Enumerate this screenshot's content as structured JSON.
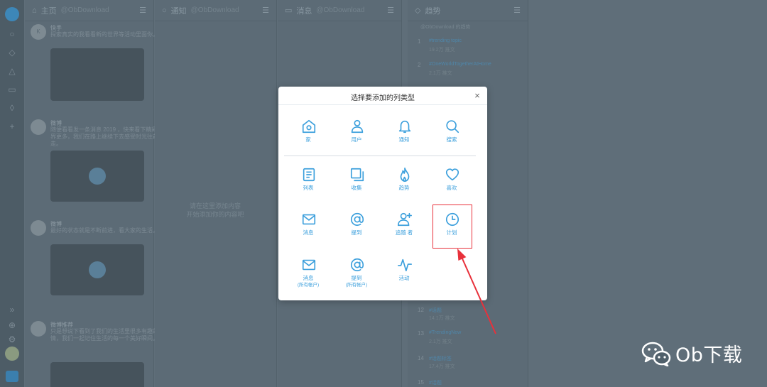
{
  "background": {
    "columns": [
      {
        "title": "主页",
        "subtitle": "@ObDownload",
        "icon": "home-icon"
      },
      {
        "title": "通知",
        "subtitle": "@ObDownload",
        "icon": "bell-icon"
      },
      {
        "title": "消息",
        "subtitle": "@ObDownload",
        "icon": "mail-icon"
      },
      {
        "title": "趋势",
        "subtitle": "",
        "icon": "trend-icon"
      }
    ],
    "tweets": [
      {
        "name": "快手",
        "text": "探索真实的我看看新的世界等活动里面你。"
      },
      {
        "name": "微博",
        "text": "随便看看发一条消息 2019 ，快来看下精彩世界更多，我们在路上继续下去感受时光往前走。"
      },
      {
        "name": "微博",
        "text": "最好的状态就是不断前进，看大家的生活。"
      },
      {
        "name": "微博推荐",
        "text": "只是想说下看到了我们的生活里很多有趣的事情，我们一起记住生活的每一个美好瞬间。"
      }
    ],
    "empty_message": [
      "请在这里添加内容",
      "开始添加你的内容吧"
    ],
    "trends_header": "@ObDownload 的趋势",
    "trends": [
      {
        "rank": "1",
        "name": "#trending topic",
        "count": "19.2万 推文"
      },
      {
        "rank": "2",
        "name": "#OneWorldTogetherAtHome",
        "count": "2.1万 推文"
      },
      {
        "rank": "12",
        "name": "#话题",
        "count": "14.1万 推文"
      },
      {
        "rank": "13",
        "name": "#TrendingNow",
        "count": "2.1万 推文"
      },
      {
        "rank": "14",
        "name": "#话题标签",
        "count": "17.4万 推文"
      },
      {
        "rank": "15",
        "name": "#话题",
        "count": ""
      }
    ]
  },
  "modal": {
    "title": "选择要添加的列类型",
    "close_label": "×",
    "options": [
      {
        "label": "家",
        "sub": "",
        "icon": "home-icon"
      },
      {
        "label": "用户",
        "sub": "",
        "icon": "user-icon"
      },
      {
        "label": "通知",
        "sub": "",
        "icon": "bell-icon"
      },
      {
        "label": "搜索",
        "sub": "",
        "icon": "search-icon"
      },
      {
        "label": "列表",
        "sub": "",
        "icon": "list-icon"
      },
      {
        "label": "收集",
        "sub": "",
        "icon": "collection-icon"
      },
      {
        "label": "趋势",
        "sub": "",
        "icon": "flame-icon"
      },
      {
        "label": "喜欢",
        "sub": "",
        "icon": "heart-icon"
      },
      {
        "label": "消息",
        "sub": "",
        "icon": "mail-icon"
      },
      {
        "label": "提到",
        "sub": "",
        "icon": "at-icon"
      },
      {
        "label": "追随 者",
        "sub": "",
        "icon": "add-user-icon"
      },
      {
        "label": "计划",
        "sub": "",
        "icon": "clock-icon"
      },
      {
        "label": "消息",
        "sub": "(所有帐户)",
        "icon": "mail-icon"
      },
      {
        "label": "提到",
        "sub": "(所有帐户)",
        "icon": "at-icon"
      },
      {
        "label": "活动",
        "sub": "",
        "icon": "activity-icon"
      }
    ]
  },
  "colors": {
    "accent": "#3b9fdc",
    "highlight": "#e8313b",
    "overlay": "#5f6e79"
  },
  "watermark": {
    "text": "Ob下载",
    "icon": "wechat-icon"
  }
}
